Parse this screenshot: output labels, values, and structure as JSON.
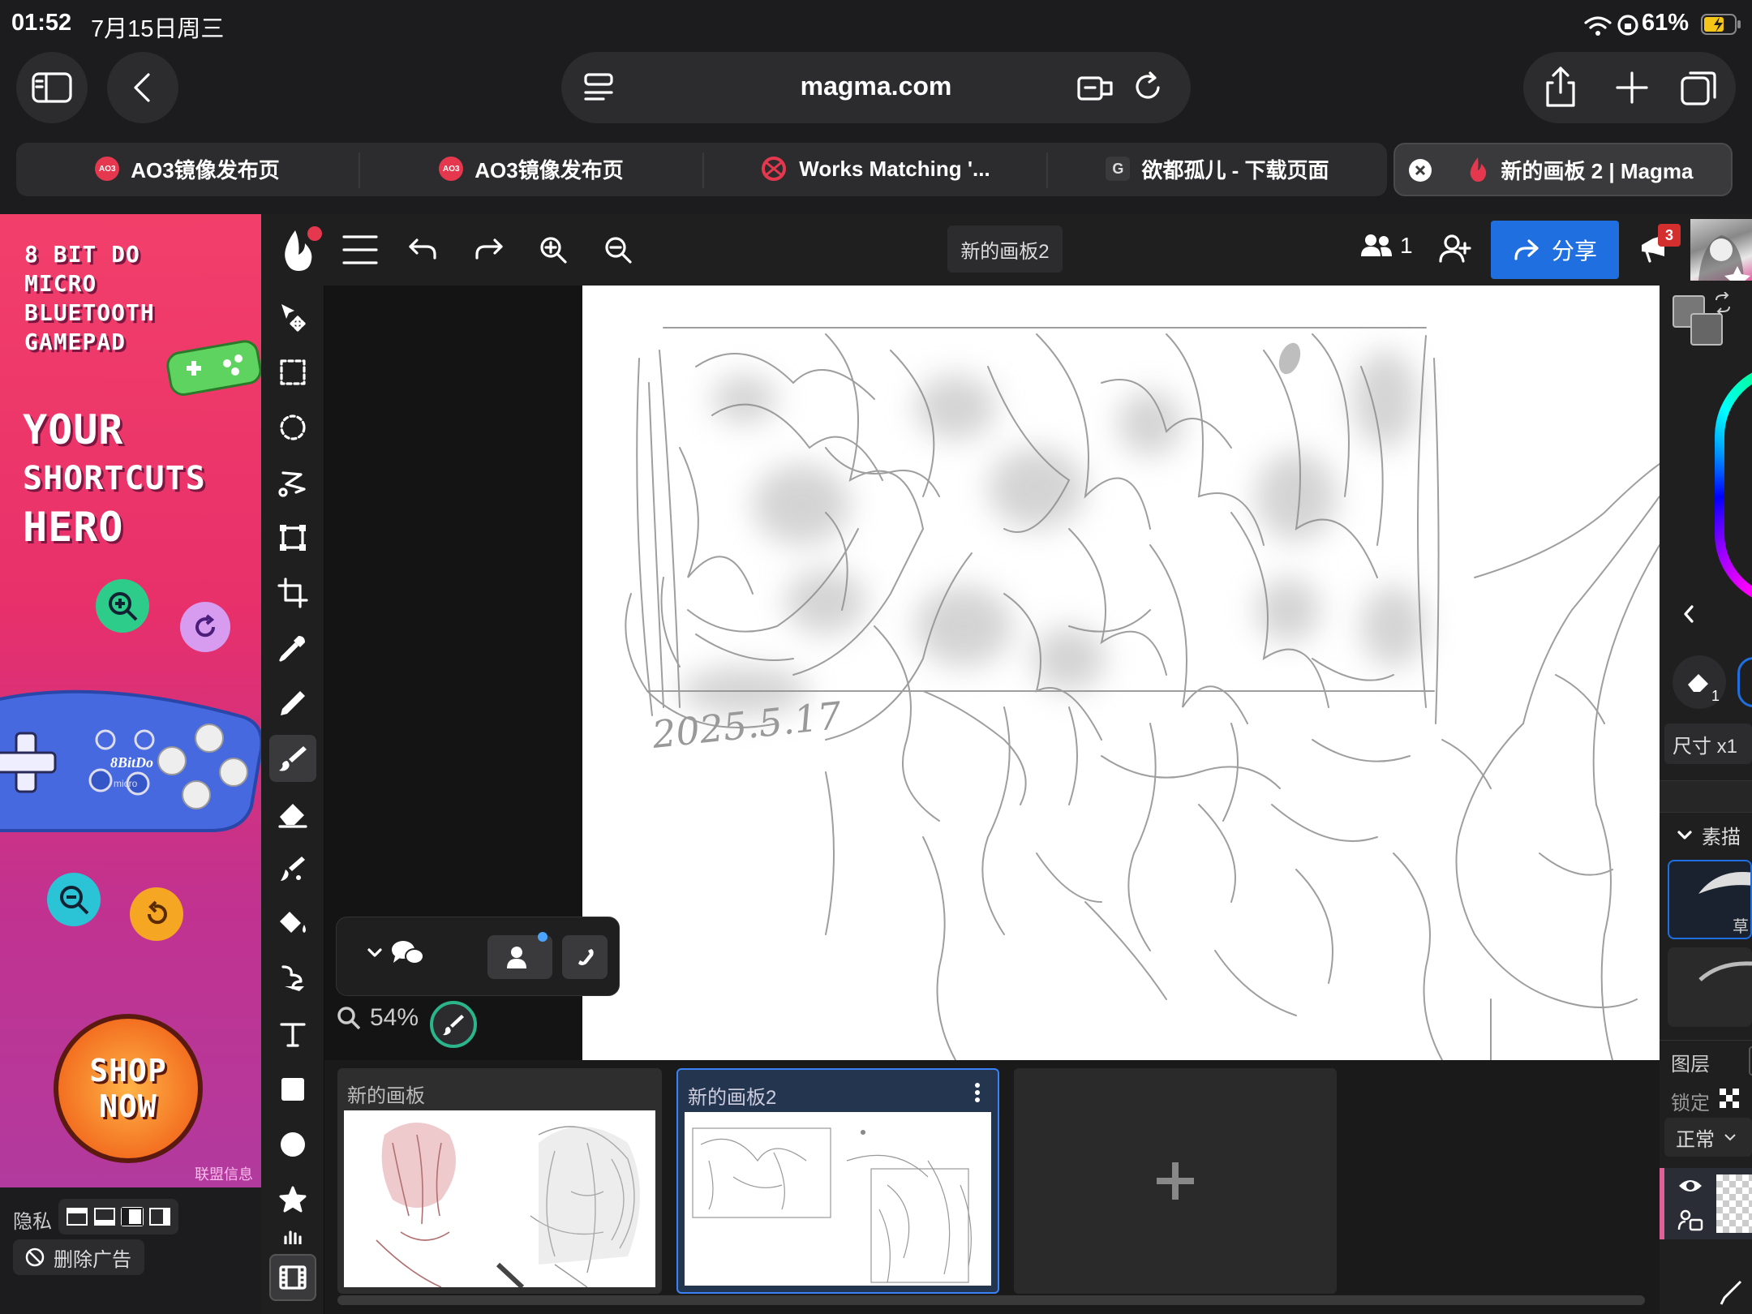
{
  "status": {
    "time": "01:52",
    "date": "7月15日周三",
    "battery": "61%"
  },
  "browser": {
    "url": "magma.com"
  },
  "tabs": [
    {
      "label": "AO3镜像发布页",
      "favicon": "ao3-icon"
    },
    {
      "label": "AO3镜像发布页",
      "favicon": "ao3-icon"
    },
    {
      "label": "Works Matching '...",
      "favicon": "ao3-logo-icon"
    },
    {
      "label": "欲都孤儿 - 下载页面",
      "favicon": "g-icon",
      "favicon_text": "G"
    },
    {
      "label": "新的画板 2 | Magma",
      "favicon": "magma-icon",
      "active": true
    }
  ],
  "ad": {
    "brand_line1": "8 BIT DO",
    "brand_line2": "MICRO",
    "brand_line3": "BLUETOOTH",
    "brand_line4": "GAMEPAD",
    "headline1": "YOUR",
    "headline2": "SHORTCUTS",
    "headline3": "HERO",
    "cta_line1": "SHOP",
    "cta_line2": "NOW",
    "gamepad_brand": "8BitDo",
    "gamepad_model": "micro",
    "affiliate": "联盟信息",
    "privacy_label": "隐私",
    "remove_ads": "删除广告"
  },
  "app": {
    "board_title": "新的画板2",
    "users_count": "1",
    "share_label": "分享",
    "notification_count": "3",
    "zoom": "54%",
    "canvas_sketch_date": "2025.5.17"
  },
  "right_panel": {
    "size_label": "尺寸 x1",
    "eraser_badge": "1",
    "brush_group": "素描",
    "brush_item1": "草",
    "layers_label": "图层",
    "lock_label": "锁定",
    "blend_mode": "正常"
  },
  "boards": [
    {
      "name": "新的画板"
    },
    {
      "name": "新的画板2",
      "active": true
    }
  ],
  "colors": {
    "accent": "#1f6fe0",
    "active_board_border": "#3b82f6",
    "brand_red": "#e5384f"
  }
}
